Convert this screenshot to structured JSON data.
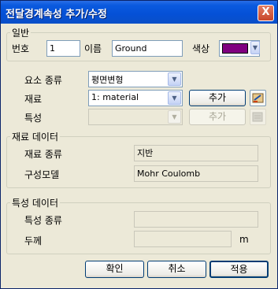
{
  "window": {
    "title": "전달경계속성 추가/수정",
    "close_label": "X"
  },
  "general": {
    "legend": "일반",
    "number_label": "번호",
    "number_value": "1",
    "name_label": "이름",
    "name_value": "Ground",
    "color_label": "색상",
    "color_value": "#800080"
  },
  "element": {
    "type_label": "요소 종류",
    "type_value": "평면변형",
    "material_label": "재료",
    "material_value": "1: material",
    "material_add_label": "추가",
    "property_label": "특성",
    "property_value": "",
    "property_add_label": "추가"
  },
  "material_data": {
    "legend": "재료 데이터",
    "type_label": "재료 종류",
    "type_value": "지반",
    "model_label": "구성모델",
    "model_value": "Mohr Coulomb"
  },
  "property_data": {
    "legend": "특성 데이터",
    "type_label": "특성 종류",
    "type_value": "",
    "thickness_label": "두께",
    "thickness_value": "",
    "thickness_unit": "m"
  },
  "buttons": {
    "ok": "확인",
    "cancel": "취소",
    "apply": "적용"
  }
}
